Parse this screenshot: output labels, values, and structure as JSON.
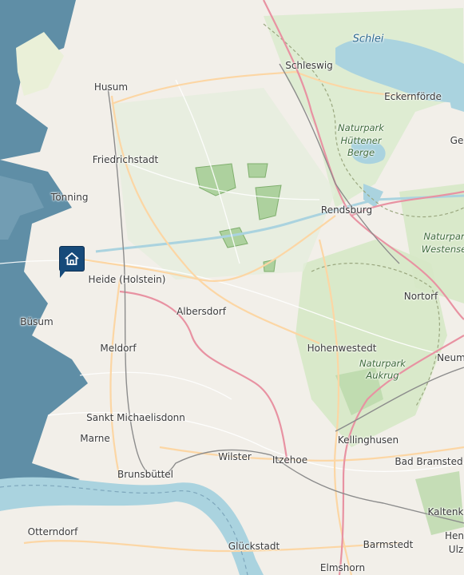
{
  "map": {
    "places": {
      "husum": "Husum",
      "schleswig": "Schleswig",
      "eckernfoerde": "Eckernförde",
      "ge": "Ge",
      "friedrichstadt": "Friedrichstadt",
      "tonning": "Tönning",
      "rendsburg": "Rendsburg",
      "heide": "Heide (Holstein)",
      "albersdorf": "Albersdorf",
      "buesum": "Büsum",
      "nortorf": "Nortorf",
      "meldorf": "Meldorf",
      "hohenwestedt": "Hohenwestedt",
      "neum": "Neum",
      "sankt_michaelisdonn": "Sankt Michaelisdonn",
      "kellinghusen": "Kellinghusen",
      "marne": "Marne",
      "bad_bramstedt": "Bad Bramsted",
      "wilster": "Wilster",
      "itzehoe": "Itzehoe",
      "brunsbuettel": "Brunsbüttel",
      "kaltenk": "Kaltenk",
      "hen": "Hen",
      "ulz": "Ulz",
      "otterndorf": "Otterndorf",
      "glueckstadt": "Glückstadt",
      "barmstedt": "Barmstedt",
      "elmshorn": "Elmshorn"
    },
    "water": {
      "schlei": "Schlei"
    },
    "parks": {
      "huettener_l1": "Naturpark",
      "huettener_l2": "Hüttener",
      "huettener_l3": "Berge",
      "westensee_l1": "Naturpar",
      "westensee_l2": "Westense",
      "aukrug_l1": "Naturpark",
      "aukrug_l2": "Aukrug"
    },
    "marker": {
      "icon": "home-icon",
      "color": "#164a7a"
    },
    "colors": {
      "land": "#f2efe9",
      "sea": "#aad3df",
      "mudflat": "#5f8ea6",
      "park_fill": "#d8e8c8",
      "forest": "#add19e",
      "motorway": "#e892a2",
      "primary": "#fcd6a4",
      "boundary": "#9aa77f"
    }
  }
}
